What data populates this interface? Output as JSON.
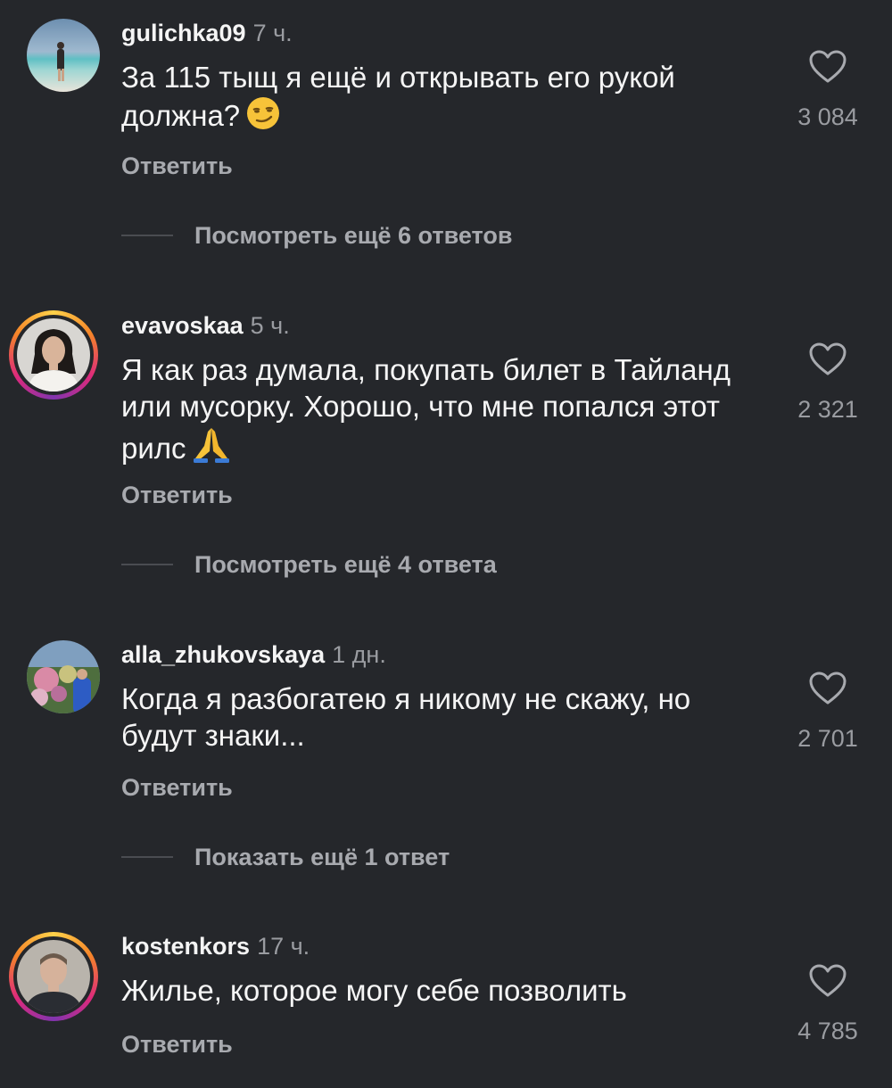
{
  "comments": [
    {
      "username": "gulichka09",
      "time": "7 ч.",
      "text": "За 115 тыщ я ещё и открывать его рукой должна?",
      "emoji": "smirking-face",
      "likes": "3 084",
      "reply_label": "Ответить",
      "more_label": "Посмотреть ещё 6 ответов"
    },
    {
      "username": "evavoskaa",
      "time": "5 ч.",
      "text": "Я как раз думала, покупать билет в Тайланд или мусорку. Хорошо, что мне попался этот рилс",
      "emoji": "folded-hands",
      "likes": "2 321",
      "reply_label": "Ответить",
      "more_label": "Посмотреть ещё 4 ответа"
    },
    {
      "username": "alla_zhukovskaya",
      "time": "1 дн.",
      "text": "Когда я разбогатею я никому не скажу, но будут знаки...",
      "likes": "2 701",
      "reply_label": "Ответить",
      "more_label": "Показать ещё 1 ответ"
    },
    {
      "username": "kostenkors",
      "time": "17 ч.",
      "text": "Жилье, которое могу себе позволить",
      "likes": "4 785",
      "reply_label": "Ответить"
    }
  ],
  "icons": {
    "like": "heart-outline-icon"
  },
  "colors": {
    "background": "#25272b",
    "primary_text": "#f5f5f5",
    "secondary_text": "#9a9ca1",
    "story_ring": [
      "#ffd24a",
      "#f58529",
      "#dd2a7b",
      "#8134af"
    ]
  }
}
